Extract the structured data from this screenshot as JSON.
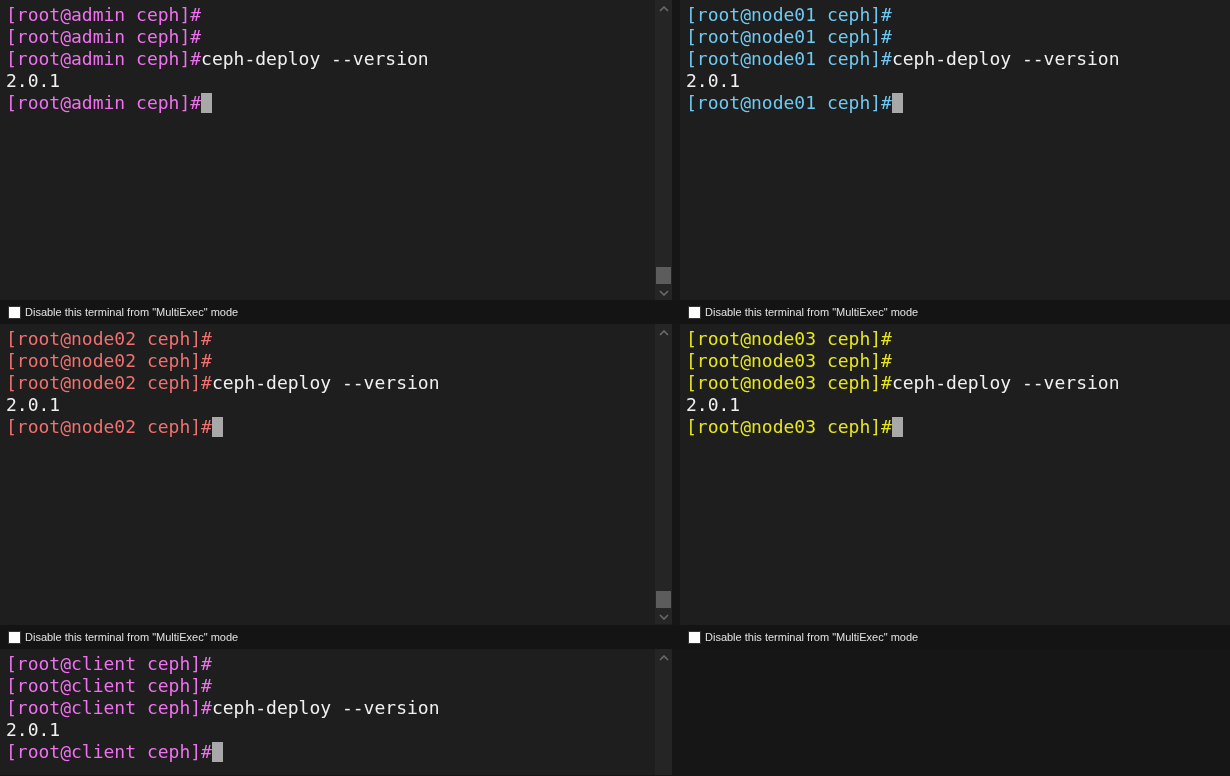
{
  "terminals": [
    {
      "color": "#f071f0",
      "scrollbar": true,
      "lines": [
        {
          "kind": "prompt",
          "prompt": "[root@admin ceph]#",
          "cursor": false
        },
        {
          "kind": "prompt",
          "prompt": "[root@admin ceph]#",
          "cursor": false
        },
        {
          "kind": "prompt",
          "prompt": "[root@admin ceph]#",
          "command": "ceph-deploy --version",
          "cursor": false
        },
        {
          "kind": "output",
          "text": "2.0.1"
        },
        {
          "kind": "prompt",
          "prompt": "[root@admin ceph]#",
          "cursor": true
        }
      ],
      "footer": {
        "label": "Disable this terminal from \"MultiExec\" mode",
        "checked": false
      }
    },
    {
      "color": "#6fc9f2",
      "scrollbar": false,
      "lines": [
        {
          "kind": "prompt",
          "prompt": "[root@node01 ceph]#",
          "cursor": false
        },
        {
          "kind": "prompt",
          "prompt": "[root@node01 ceph]#",
          "cursor": false
        },
        {
          "kind": "prompt",
          "prompt": "[root@node01 ceph]#",
          "command": "ceph-deploy --version",
          "cursor": false
        },
        {
          "kind": "output",
          "text": "2.0.1"
        },
        {
          "kind": "prompt",
          "prompt": "[root@node01 ceph]#",
          "cursor": true
        }
      ],
      "footer": {
        "label": "Disable this terminal from \"MultiExec\" mode",
        "checked": false
      }
    },
    {
      "color": "#f0716f",
      "scrollbar": true,
      "lines": [
        {
          "kind": "prompt",
          "prompt": "[root@node02 ceph]#",
          "cursor": false
        },
        {
          "kind": "prompt",
          "prompt": "[root@node02 ceph]#",
          "cursor": false
        },
        {
          "kind": "prompt",
          "prompt": "[root@node02 ceph]#",
          "command": "ceph-deploy --version",
          "cursor": false
        },
        {
          "kind": "output",
          "text": "2.0.1"
        },
        {
          "kind": "prompt",
          "prompt": "[root@node02 ceph]#",
          "cursor": true
        }
      ],
      "footer": {
        "label": "Disable this terminal from \"MultiExec\" mode",
        "checked": false
      }
    },
    {
      "color": "#e6e61e",
      "scrollbar": false,
      "lines": [
        {
          "kind": "prompt",
          "prompt": "[root@node03 ceph]#",
          "cursor": false
        },
        {
          "kind": "prompt",
          "prompt": "[root@node03 ceph]#",
          "cursor": false
        },
        {
          "kind": "prompt",
          "prompt": "[root@node03 ceph]#",
          "command": "ceph-deploy --version",
          "cursor": false
        },
        {
          "kind": "output",
          "text": "2.0.1"
        },
        {
          "kind": "prompt",
          "prompt": "[root@node03 ceph]#",
          "cursor": true
        }
      ],
      "footer": {
        "label": "Disable this terminal from \"MultiExec\" mode",
        "checked": false
      }
    },
    {
      "color": "#f071f0",
      "scrollbar": true,
      "lines": [
        {
          "kind": "prompt",
          "prompt": "[root@client ceph]#",
          "cursor": false
        },
        {
          "kind": "prompt",
          "prompt": "[root@client ceph]#",
          "cursor": false
        },
        {
          "kind": "prompt",
          "prompt": "[root@client ceph]#",
          "command": "ceph-deploy --version",
          "cursor": false
        },
        {
          "kind": "output",
          "text": "2.0.1"
        },
        {
          "kind": "prompt",
          "prompt": "[root@client ceph]#",
          "cursor": true
        }
      ]
    }
  ]
}
